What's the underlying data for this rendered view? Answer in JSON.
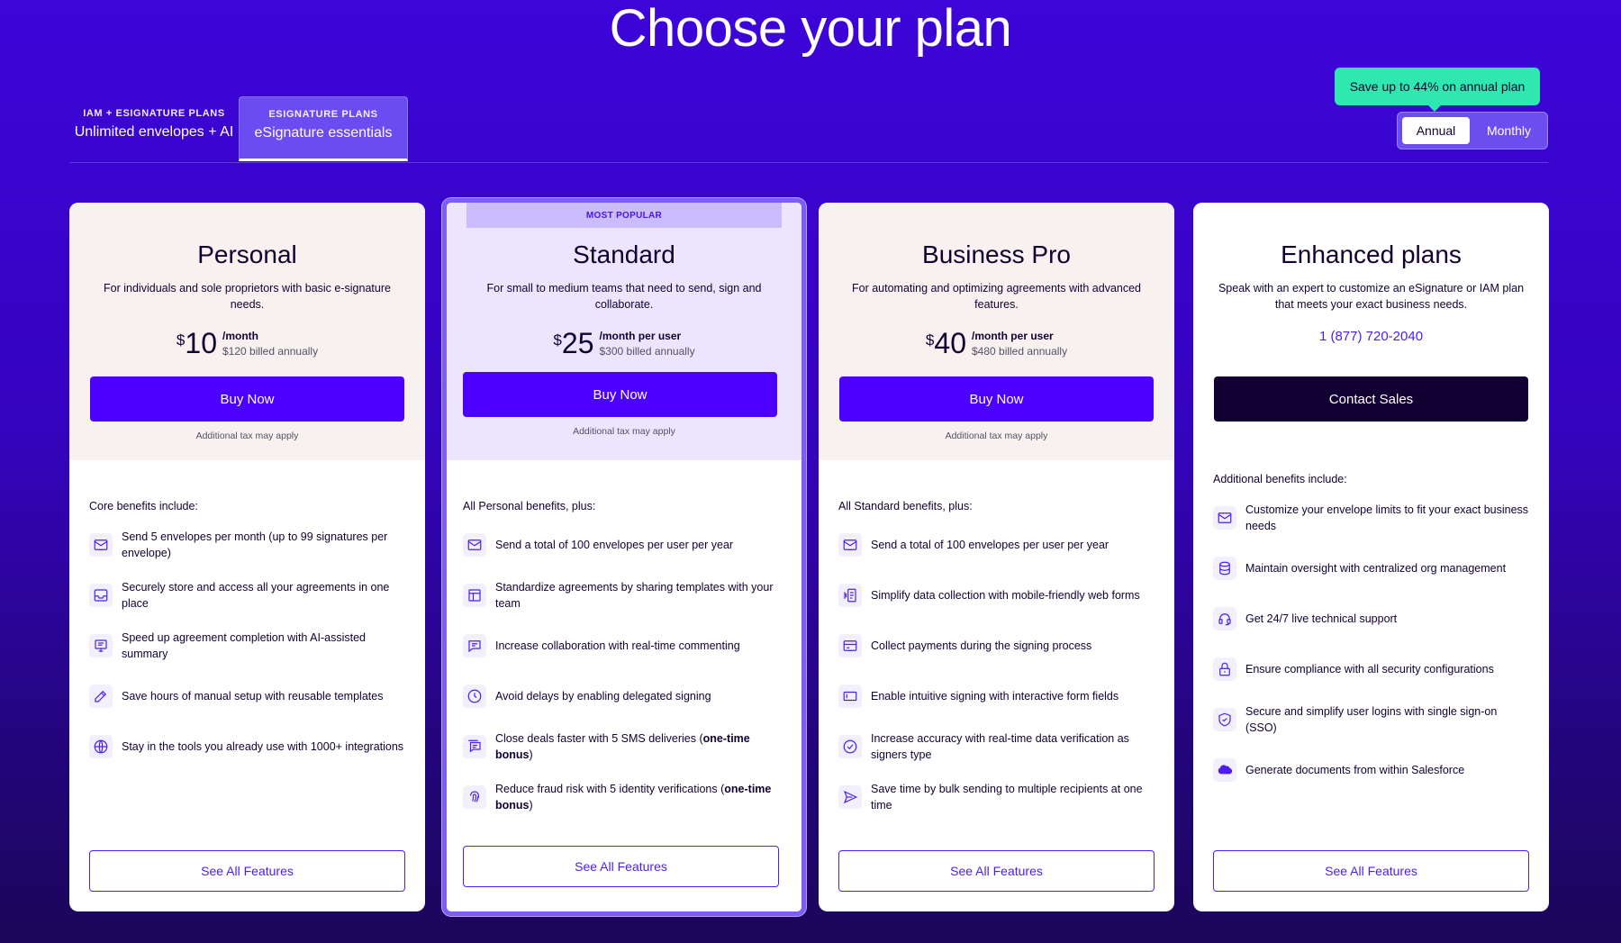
{
  "header": {
    "title": "Choose your plan"
  },
  "tabs": [
    {
      "sub": "IAM + ESIGNATURE PLANS",
      "label": "Unlimited envelopes + AI"
    },
    {
      "sub": "ESIGNATURE PLANS",
      "label": "eSignature essentials"
    }
  ],
  "billing": {
    "tooltip": "Save up to 44% on annual plan",
    "annual": "Annual",
    "monthly": "Monthly",
    "selected": "Annual"
  },
  "plans": [
    {
      "name": "Personal",
      "description": "For individuals and sole proprietors with basic e-signature needs.",
      "currency": "$",
      "price": "10",
      "unit": "/month",
      "annual": "$120 billed annually",
      "cta": "Buy Now",
      "tax": "Additional tax may apply",
      "intro": "Core benefits include:",
      "benefits": [
        {
          "icon": "envelope-icon",
          "text": "Send 5 envelopes per month (up to 99 signatures per envelope)"
        },
        {
          "icon": "inbox-icon",
          "text": "Securely store and access all your agreements in one place"
        },
        {
          "icon": "summary-icon",
          "text": "Speed up agreement completion with AI-assisted summary"
        },
        {
          "icon": "edit-icon",
          "text": "Save hours of manual setup with reusable templates"
        },
        {
          "icon": "globe-icon",
          "text": "Stay in the tools you already use with 1000+ integrations"
        }
      ],
      "see_all": "See All Features"
    },
    {
      "badge": "MOST POPULAR",
      "name": "Standard",
      "description": "For small to medium teams that need to send, sign and collaborate.",
      "currency": "$",
      "price": "25",
      "unit": "/month per user",
      "annual": "$300 billed annually",
      "cta": "Buy Now",
      "tax": "Additional tax may apply",
      "intro": "All Personal benefits, plus:",
      "benefits": [
        {
          "icon": "envelope-icon",
          "text": "Send a total of 100 envelopes per user per year"
        },
        {
          "icon": "template-icon",
          "text": "Standardize agreements by sharing templates with your team"
        },
        {
          "icon": "comment-icon",
          "text": "Increase collaboration with real-time commenting"
        },
        {
          "icon": "clock-icon",
          "text": "Avoid delays by enabling delegated signing"
        },
        {
          "icon": "sms-icon",
          "text": "Close deals faster with 5 SMS deliveries",
          "bold": "one-time bonus"
        },
        {
          "icon": "fingerprint-icon",
          "text": "Reduce fraud risk with 5 identity verifications",
          "bold": "one-time bonus"
        }
      ],
      "see_all": "See All Features"
    },
    {
      "name": "Business Pro",
      "description": "For automating and optimizing agreements with advanced features.",
      "currency": "$",
      "price": "40",
      "unit": "/month per user",
      "annual": "$480 billed annually",
      "cta": "Buy Now",
      "tax": "Additional tax may apply",
      "intro": "All Standard benefits, plus:",
      "benefits": [
        {
          "icon": "envelope-icon",
          "text": "Send a total of 100 envelopes per user per year"
        },
        {
          "icon": "webform-icon",
          "text": "Simplify data collection with mobile-friendly web forms"
        },
        {
          "icon": "card-icon",
          "text": "Collect payments during the signing process"
        },
        {
          "icon": "form-field-icon",
          "text": "Enable intuitive signing with interactive form fields"
        },
        {
          "icon": "check-circle-icon",
          "text": "Increase accuracy with real-time data verification as signers type"
        },
        {
          "icon": "send-icon",
          "text": "Save time by bulk sending to multiple recipients at one time"
        }
      ],
      "see_all": "See All Features"
    },
    {
      "name": "Enhanced plans",
      "description": "Speak with an expert to customize an eSignature or IAM plan that meets your exact business needs.",
      "phone": "1 (877) 720-2040",
      "cta": "Contact Sales",
      "intro": "Additional benefits include:",
      "benefits": [
        {
          "icon": "envelope-icon",
          "text": "Customize your envelope limits to fit your exact business needs"
        },
        {
          "icon": "database-icon",
          "text": "Maintain oversight with centralized org management"
        },
        {
          "icon": "headset-icon",
          "text": "Get 24/7 live technical support"
        },
        {
          "icon": "lock-icon",
          "text": "Ensure compliance with all security configurations"
        },
        {
          "icon": "shield-icon",
          "text": "Secure and simplify user logins with single sign-on (SSO)"
        },
        {
          "icon": "salesforce-icon",
          "text": "Generate documents from within Salesforce"
        }
      ],
      "see_all": "See All Features"
    }
  ]
}
